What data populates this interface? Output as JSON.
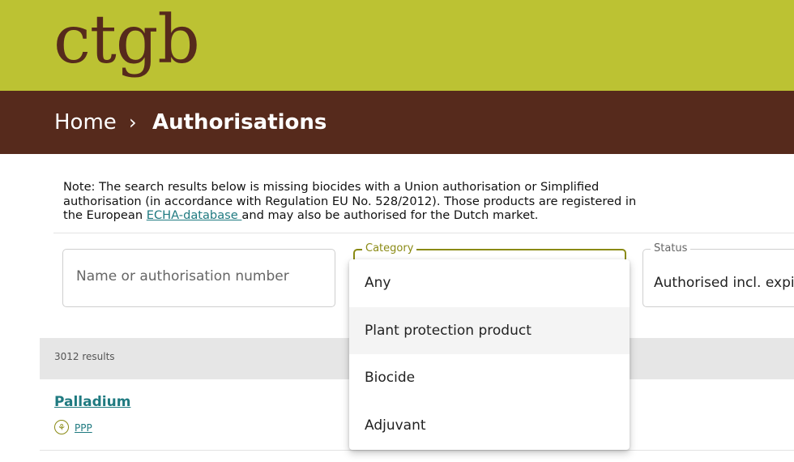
{
  "header": {
    "logo_text": "ctgb"
  },
  "breadcrumb": {
    "home": "Home",
    "separator": "›",
    "current": "Authorisations"
  },
  "note": {
    "text_before": "Note: The search results below is missing biocides with a Union authorisation or Simplified authorisation (in accordance with Regulation EU No. 528/2012). Those products are registered in the European ",
    "link_text": "ECHA-database ",
    "text_after": "and may also be authorised for the Dutch market."
  },
  "filters": {
    "name": {
      "placeholder": "Name or authorisation number",
      "value": ""
    },
    "category": {
      "label": "Category"
    },
    "status": {
      "label": "Status",
      "value": "Authorised incl. expi"
    }
  },
  "category_options": [
    "Any",
    "Plant protection product",
    "Biocide",
    "Adjuvant"
  ],
  "highlighted_option": "Plant protection product",
  "results": {
    "count_text": "3012 results",
    "items": [
      {
        "title": "Palladium",
        "type_label": "PPP",
        "type_icon": "wheat-icon"
      }
    ]
  },
  "colors": {
    "topbar": "#bcc233",
    "brand_brown": "#562a1c",
    "link": "#1f7a80",
    "focus_border": "#8a8a14"
  }
}
